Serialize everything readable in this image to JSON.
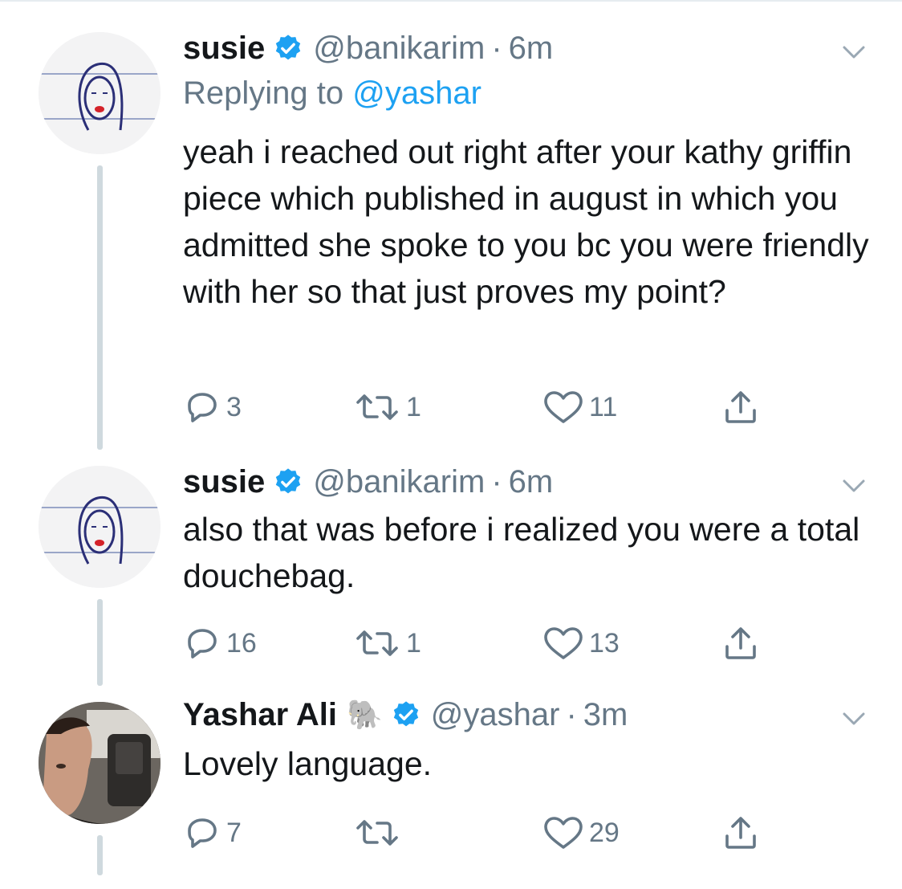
{
  "tweets": [
    {
      "name": "susie",
      "handle": "@banikarim",
      "separator": "·",
      "time": "6m",
      "replying_prefix": "Replying to",
      "replying_to": "@yashar",
      "text": "yeah i reached out right after your kathy griffin piece which published in august in which you admitted she spoke to you bc you were friendly with her so that just proves my point?",
      "replies": "3",
      "retweets": "1",
      "likes": "11"
    },
    {
      "name": "susie",
      "handle": "@banikarim",
      "separator": "·",
      "time": "6m",
      "text": "also that was before i realized you were a total douchebag.",
      "replies": "16",
      "retweets": "1",
      "likes": "13"
    },
    {
      "name": "Yashar Ali",
      "name_emoji": "🐘",
      "handle": "@yashar",
      "separator": "·",
      "time": "3m",
      "text": "Lovely language.",
      "replies": "7",
      "retweets": "",
      "likes": "29"
    }
  ],
  "icons": {
    "verified": "verified-badge-icon",
    "chevron": "chevron-down-icon",
    "reply": "reply-icon",
    "retweet": "retweet-icon",
    "like": "heart-icon",
    "share": "share-icon"
  },
  "colors": {
    "accent": "#1da1f2",
    "secondary_text": "#657786",
    "thread_line": "#cfd9de"
  }
}
